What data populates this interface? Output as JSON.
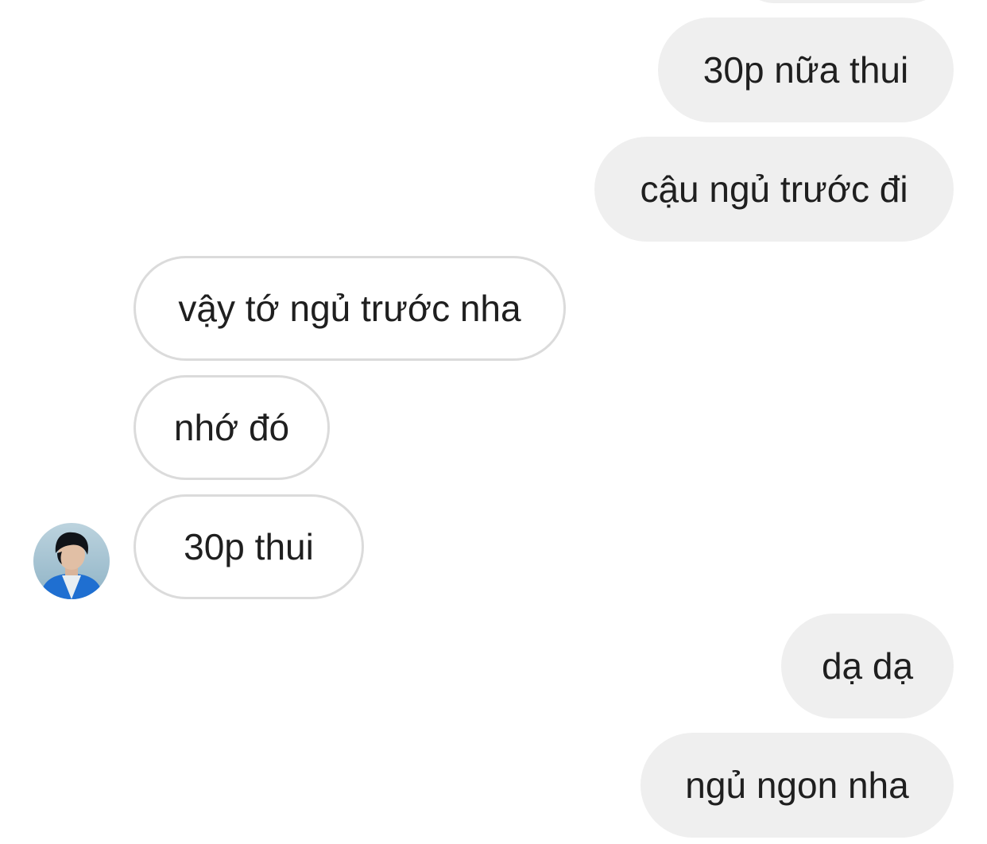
{
  "thread": {
    "messages": [
      {
        "id": "m1",
        "from": "me",
        "text": "30p nữa thui"
      },
      {
        "id": "m2",
        "from": "me",
        "text": "cậu ngủ trước đi"
      },
      {
        "id": "m3",
        "from": "them",
        "text": "vậy tớ ngủ trước nha"
      },
      {
        "id": "m4",
        "from": "them",
        "text": "nhớ đó"
      },
      {
        "id": "m5",
        "from": "them",
        "text": "30p thui"
      },
      {
        "id": "m6",
        "from": "me",
        "text": "dạ dạ"
      },
      {
        "id": "m7",
        "from": "me",
        "text": "ngủ ngon nha"
      }
    ]
  },
  "colors": {
    "sent_bubble": "#efefef",
    "received_border": "#dbdbdb",
    "text": "#1f1f1f",
    "background": "#ffffff"
  },
  "icons": {
    "avatar": "profile-photo-avatar"
  }
}
